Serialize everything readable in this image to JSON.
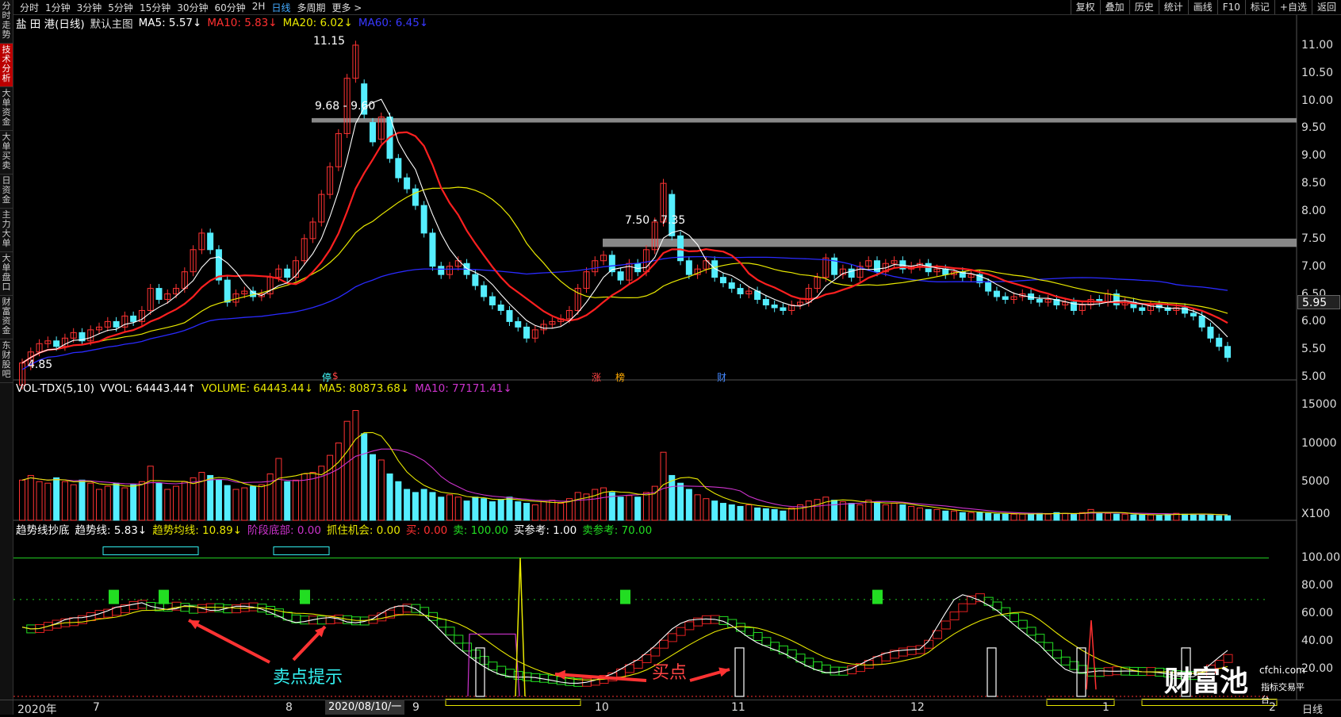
{
  "sidebar": {
    "items": [
      {
        "label": "分时走势",
        "active": false
      },
      {
        "label": "技术分析",
        "active": true
      },
      {
        "label": "大单资金",
        "active": false
      },
      {
        "label": "大单买卖",
        "active": false
      },
      {
        "label": "日资金",
        "active": false
      },
      {
        "label": "主力大单",
        "active": false
      },
      {
        "label": "大单盘口",
        "active": false
      },
      {
        "label": "财富资金",
        "active": false
      },
      {
        "label": "东财股吧",
        "active": false
      }
    ]
  },
  "toolbar": {
    "timeframes": [
      "分时",
      "1分钟",
      "3分钟",
      "5分钟",
      "15分钟",
      "30分钟",
      "60分钟",
      "2H",
      "日线",
      "多周期",
      "更多 >"
    ],
    "selected": "日线",
    "right_buttons": [
      "复权",
      "叠加",
      "历史",
      "统计",
      "画线",
      "F10",
      "标记",
      "+自选",
      "返回"
    ]
  },
  "main_legend": {
    "stock": "盐 田 港(日线)",
    "template": "默认主图",
    "ma5": "MA5: 5.57↓",
    "ma10": "MA10: 5.83↓",
    "ma20": "MA20: 6.02↓",
    "ma60": "MA60: 6.45↓"
  },
  "vol_legend": {
    "name": "VOL-TDX(5,10)",
    "vvol": "VVOL: 64443.44↑",
    "volume": "VOLUME: 64443.44↓",
    "ma5": "MA5: 80873.68↓",
    "ma10": "MA10: 77171.41↓"
  },
  "ind_legend": {
    "name": "趋势线抄底",
    "trend": "趋势线: 5.83↓",
    "trend_avg": "趋势均线: 10.89↓",
    "stage_bottom": "阶段底部: 0.00",
    "grab": "抓住机会: 0.00",
    "buy": "买: 0.00",
    "sell": "卖: 100.00",
    "buy_ref": "买参考: 1.00",
    "sell_ref": "卖参考: 70.00"
  },
  "price_axis": {
    "ticks": [
      "11.00",
      "10.50",
      "10.00",
      "9.50",
      "9.00",
      "8.50",
      "8.00",
      "7.50",
      "7.00",
      "6.50",
      "6.00",
      "5.50",
      "5.00"
    ],
    "last_price": "5.95"
  },
  "vol_axis": {
    "ticks": [
      "15000",
      "10000",
      "5000"
    ],
    "unit": "X100"
  },
  "ind_axis": {
    "ticks": [
      "100.00",
      "80.00",
      "60.00",
      "40.00",
      "20.00"
    ]
  },
  "annotations": {
    "high": "11.15",
    "low": "4.85",
    "range1": "9.68 - 9.60",
    "range2": "7.50 - 7.35",
    "sell_hint": "卖点提示",
    "buy_point": "买点",
    "markers": [
      {
        "text": "停",
        "color": "#4ff"
      },
      {
        "text": "$",
        "color": "#f44"
      },
      {
        "text": "涨",
        "color": "#f44"
      },
      {
        "text": "榜",
        "color": "#fa0"
      },
      {
        "text": "财",
        "color": "#48f"
      }
    ],
    "date_tip": "2020/08/10/一"
  },
  "x_axis": {
    "labels": [
      "2020年",
      "7",
      "8",
      "9",
      "10",
      "11",
      "12",
      "1",
      "2"
    ],
    "period": "日线"
  },
  "watermark": {
    "brand": "财富池",
    "url": "cfchi.com",
    "tag": "指标交易平台"
  },
  "colors": {
    "up": "#ff3333",
    "down": "#55eeff",
    "ma5": "#ffffff",
    "ma10": "#ff2020",
    "ma20": "#e8e800",
    "ma60": "#2a2aff",
    "vma5": "#e8e800",
    "vma10": "#cc33cc",
    "trend_up": "#e02020",
    "trend_down": "#22dd22"
  },
  "chart_data": {
    "type": "candlestick",
    "price_ylim": [
      4.7,
      11.3
    ],
    "candles": [
      [
        4.85,
        5.25
      ],
      [
        5.2,
        5.45
      ],
      [
        5.45,
        5.6
      ],
      [
        5.6,
        5.65
      ],
      [
        5.65,
        5.55
      ],
      [
        5.55,
        5.7
      ],
      [
        5.7,
        5.8
      ],
      [
        5.8,
        5.65
      ],
      [
        5.65,
        5.85
      ],
      [
        5.85,
        5.9
      ],
      [
        5.9,
        6.0
      ],
      [
        6.0,
        5.9
      ],
      [
        5.9,
        6.1
      ],
      [
        6.1,
        6.0
      ],
      [
        6.0,
        6.2
      ],
      [
        6.2,
        6.6
      ],
      [
        6.6,
        6.4
      ],
      [
        6.4,
        6.5
      ],
      [
        6.5,
        6.6
      ],
      [
        6.6,
        6.9
      ],
      [
        6.9,
        7.3
      ],
      [
        7.3,
        7.6
      ],
      [
        7.6,
        7.3
      ],
      [
        7.3,
        6.75
      ],
      [
        6.75,
        6.35
      ],
      [
        6.35,
        6.5
      ],
      [
        6.5,
        6.55
      ],
      [
        6.55,
        6.45
      ],
      [
        6.45,
        6.5
      ],
      [
        6.5,
        6.8
      ],
      [
        6.8,
        6.95
      ],
      [
        6.95,
        6.8
      ],
      [
        6.8,
        7.1
      ],
      [
        7.1,
        7.5
      ],
      [
        7.5,
        7.8
      ],
      [
        7.8,
        8.3
      ],
      [
        8.3,
        8.8
      ],
      [
        8.8,
        9.4
      ],
      [
        9.4,
        10.4
      ],
      [
        10.4,
        11.0
      ],
      [
        10.3,
        9.75
      ],
      [
        9.6,
        9.25
      ],
      [
        9.3,
        9.7
      ],
      [
        9.7,
        8.95
      ],
      [
        8.95,
        8.6
      ],
      [
        8.6,
        8.4
      ],
      [
        8.4,
        8.1
      ],
      [
        8.1,
        7.6
      ],
      [
        7.6,
        7.0
      ],
      [
        7.0,
        6.85
      ],
      [
        6.85,
        7.0
      ],
      [
        7.0,
        7.1
      ],
      [
        7.05,
        6.85
      ],
      [
        6.85,
        6.65
      ],
      [
        6.65,
        6.45
      ],
      [
        6.45,
        6.3
      ],
      [
        6.3,
        6.2
      ],
      [
        6.2,
        6.0
      ],
      [
        6.0,
        5.9
      ],
      [
        5.9,
        5.7
      ],
      [
        5.7,
        5.85
      ],
      [
        5.85,
        5.95
      ],
      [
        5.95,
        6.0
      ],
      [
        6.0,
        6.05
      ],
      [
        6.05,
        6.2
      ],
      [
        6.2,
        6.6
      ],
      [
        6.6,
        6.9
      ],
      [
        6.9,
        7.1
      ],
      [
        7.1,
        7.2
      ],
      [
        7.2,
        6.9
      ],
      [
        6.9,
        6.75
      ],
      [
        6.75,
        7.05
      ],
      [
        7.05,
        6.9
      ],
      [
        6.9,
        7.3
      ],
      [
        7.3,
        7.8
      ],
      [
        7.8,
        8.5
      ],
      [
        8.3,
        7.55
      ],
      [
        7.55,
        7.1
      ],
      [
        7.1,
        6.85
      ],
      [
        6.85,
        6.95
      ],
      [
        6.95,
        7.1
      ],
      [
        7.1,
        6.8
      ],
      [
        6.8,
        6.7
      ],
      [
        6.7,
        6.6
      ],
      [
        6.6,
        6.5
      ],
      [
        6.5,
        6.55
      ],
      [
        6.55,
        6.4
      ],
      [
        6.4,
        6.3
      ],
      [
        6.3,
        6.25
      ],
      [
        6.25,
        6.2
      ],
      [
        6.2,
        6.3
      ],
      [
        6.3,
        6.35
      ],
      [
        6.35,
        6.6
      ],
      [
        6.6,
        6.8
      ],
      [
        6.8,
        7.15
      ],
      [
        7.15,
        6.85
      ],
      [
        6.85,
        6.95
      ],
      [
        6.95,
        6.8
      ],
      [
        6.8,
        7.0
      ],
      [
        7.0,
        7.1
      ],
      [
        7.1,
        6.9
      ],
      [
        6.9,
        7.05
      ],
      [
        7.05,
        7.1
      ],
      [
        7.1,
        6.95
      ],
      [
        6.95,
        7.0
      ],
      [
        7.0,
        7.05
      ],
      [
        7.05,
        6.9
      ],
      [
        6.9,
        6.95
      ],
      [
        6.95,
        6.85
      ],
      [
        6.85,
        6.9
      ],
      [
        6.9,
        6.8
      ],
      [
        6.8,
        6.85
      ],
      [
        6.85,
        6.7
      ],
      [
        6.7,
        6.55
      ],
      [
        6.55,
        6.45
      ],
      [
        6.45,
        6.4
      ],
      [
        6.4,
        6.45
      ],
      [
        6.45,
        6.5
      ],
      [
        6.5,
        6.4
      ],
      [
        6.4,
        6.35
      ],
      [
        6.35,
        6.4
      ],
      [
        6.4,
        6.3
      ],
      [
        6.3,
        6.35
      ],
      [
        6.35,
        6.2
      ],
      [
        6.2,
        6.3
      ],
      [
        6.3,
        6.4
      ],
      [
        6.4,
        6.35
      ],
      [
        6.35,
        6.5
      ],
      [
        6.5,
        6.3
      ],
      [
        6.3,
        6.35
      ],
      [
        6.35,
        6.25
      ],
      [
        6.25,
        6.2
      ],
      [
        6.2,
        6.3
      ],
      [
        6.3,
        6.25
      ],
      [
        6.25,
        6.2
      ],
      [
        6.2,
        6.25
      ],
      [
        6.25,
        6.15
      ],
      [
        6.15,
        6.1
      ],
      [
        6.1,
        5.9
      ],
      [
        5.9,
        5.7
      ],
      [
        5.7,
        5.55
      ],
      [
        5.55,
        5.35
      ]
    ],
    "volumes": [
      52,
      58,
      50,
      48,
      55,
      50,
      46,
      52,
      48,
      40,
      44,
      48,
      42,
      46,
      50,
      70,
      48,
      40,
      44,
      50,
      55,
      62,
      58,
      52,
      45,
      40,
      42,
      44,
      46,
      60,
      80,
      50,
      52,
      60,
      62,
      70,
      84,
      100,
      128,
      142,
      112,
      85,
      78,
      60,
      50,
      40,
      36,
      40,
      36,
      30,
      33,
      30,
      25,
      30,
      28,
      24,
      27,
      30,
      24,
      22,
      20,
      24,
      26,
      22,
      28,
      36,
      34,
      40,
      42,
      36,
      30,
      32,
      30,
      36,
      44,
      88,
      58,
      48,
      40,
      33,
      28,
      25,
      22,
      20,
      18,
      20,
      16,
      15,
      14,
      12,
      16,
      20,
      25,
      27,
      30,
      26,
      24,
      22,
      20,
      26,
      24,
      20,
      22,
      20,
      18,
      16,
      14,
      14,
      12,
      12,
      10,
      10,
      10,
      9,
      8,
      8,
      8,
      8,
      9,
      9,
      8,
      10,
      9,
      8,
      10,
      14,
      10,
      9,
      8,
      8,
      7,
      7,
      7,
      7,
      8,
      9,
      8,
      8,
      8,
      7,
      6,
      6
    ]
  }
}
